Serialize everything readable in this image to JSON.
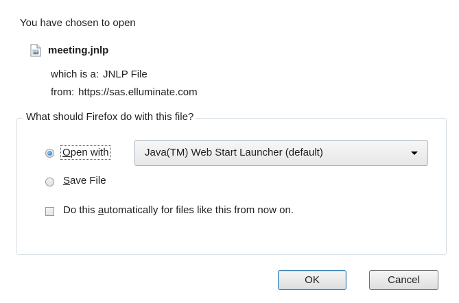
{
  "dialog": {
    "heading": "You have chosen to open",
    "file_icon": "document-icon",
    "file_name": "meeting.jnlp",
    "type_label": "which is a:",
    "type_value": "JNLP File",
    "from_label": "from:",
    "from_value": "https://sas.elluminate.com"
  },
  "action_group": {
    "legend": "What should Firefox do with this file?",
    "open_with": {
      "label_underlined": "O",
      "label_rest": "pen with",
      "selected": true
    },
    "application_select": {
      "value": "Java(TM) Web Start Launcher (default)"
    },
    "save_file": {
      "label_underlined": "S",
      "label_rest": "ave File",
      "selected": false
    },
    "auto_checkbox": {
      "label_before": "Do this ",
      "label_underlined": "a",
      "label_after": "utomatically for files like this from now on.",
      "checked": false
    }
  },
  "buttons": {
    "ok": "OK",
    "cancel": "Cancel"
  },
  "colors": {
    "accent": "#3c7fb1",
    "group_border": "#d5dfe5",
    "radio_selected": "#1b6fc2"
  }
}
